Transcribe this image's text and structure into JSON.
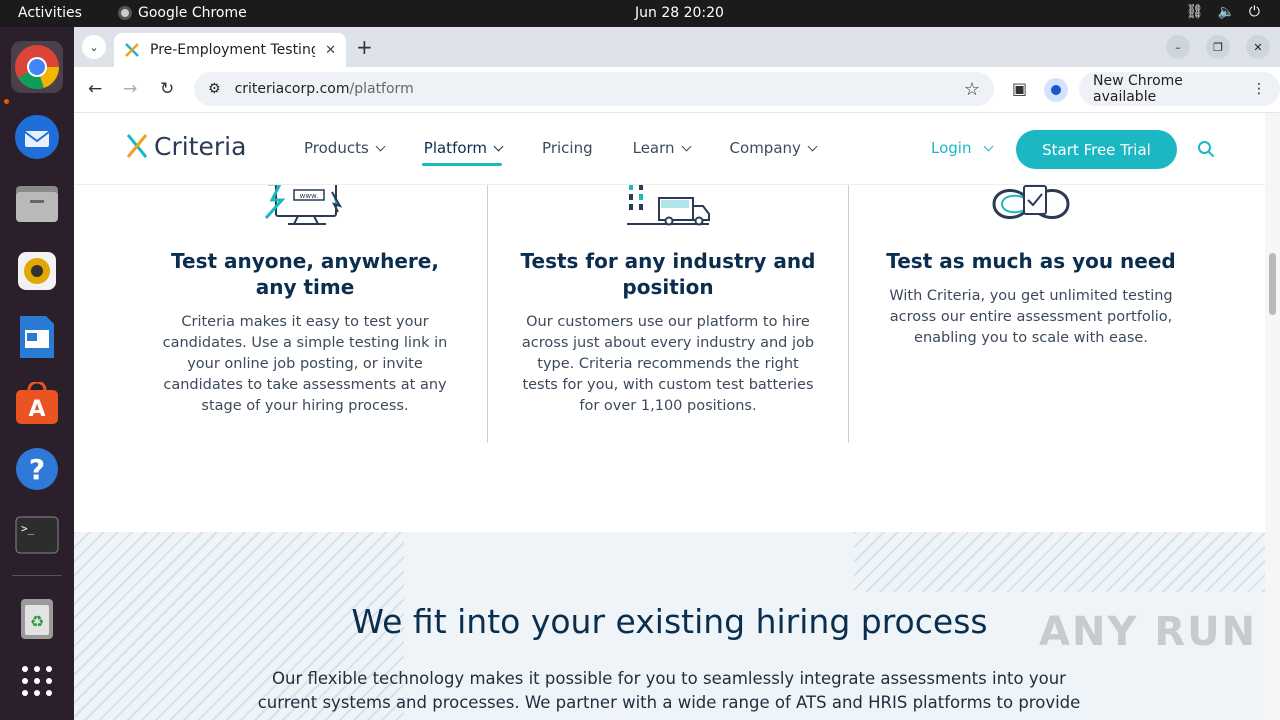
{
  "os": {
    "activities": "Activities",
    "app_name": "Google Chrome",
    "clock": "Jun 28  20:20"
  },
  "browser": {
    "tab_title": "Pre-Employment Testing",
    "url_host": "criteriacorp.com",
    "url_path": "/platform",
    "new_chrome": "New Chrome available"
  },
  "site": {
    "logo": "Criteria",
    "nav": [
      {
        "label": "Products"
      },
      {
        "label": "Platform"
      },
      {
        "label": "Pricing"
      },
      {
        "label": "Learn"
      },
      {
        "label": "Company"
      }
    ],
    "login": "Login",
    "cta": "Start Free Trial",
    "accent": "#1bb8c4",
    "navy": "#0b2e4f"
  },
  "features": [
    {
      "title": "Test anyone, anywhere, any time",
      "body": "Criteria makes it easy to test your candidates. Use a simple testing link in your online job posting, or invite candidates to take assessments at any stage of your hiring process."
    },
    {
      "title": "Tests for any industry and position",
      "body": "Our customers use our platform to hire across just about every industry and job type. Criteria recommends the right tests for you, with custom test batteries for over 1,100 positions."
    },
    {
      "title": "Test as much as you need",
      "body": "With Criteria, you get unlimited testing across our entire assessment portfolio, enabling you to scale with ease."
    }
  ],
  "section2": {
    "heading": "We fit into your existing hiring process",
    "body": "Our flexible technology makes it possible for you to seamlessly integrate assessments into your current systems and processes. We partner with a wide range of ATS and HRIS platforms to provide"
  },
  "watermark": "ANY RUN"
}
